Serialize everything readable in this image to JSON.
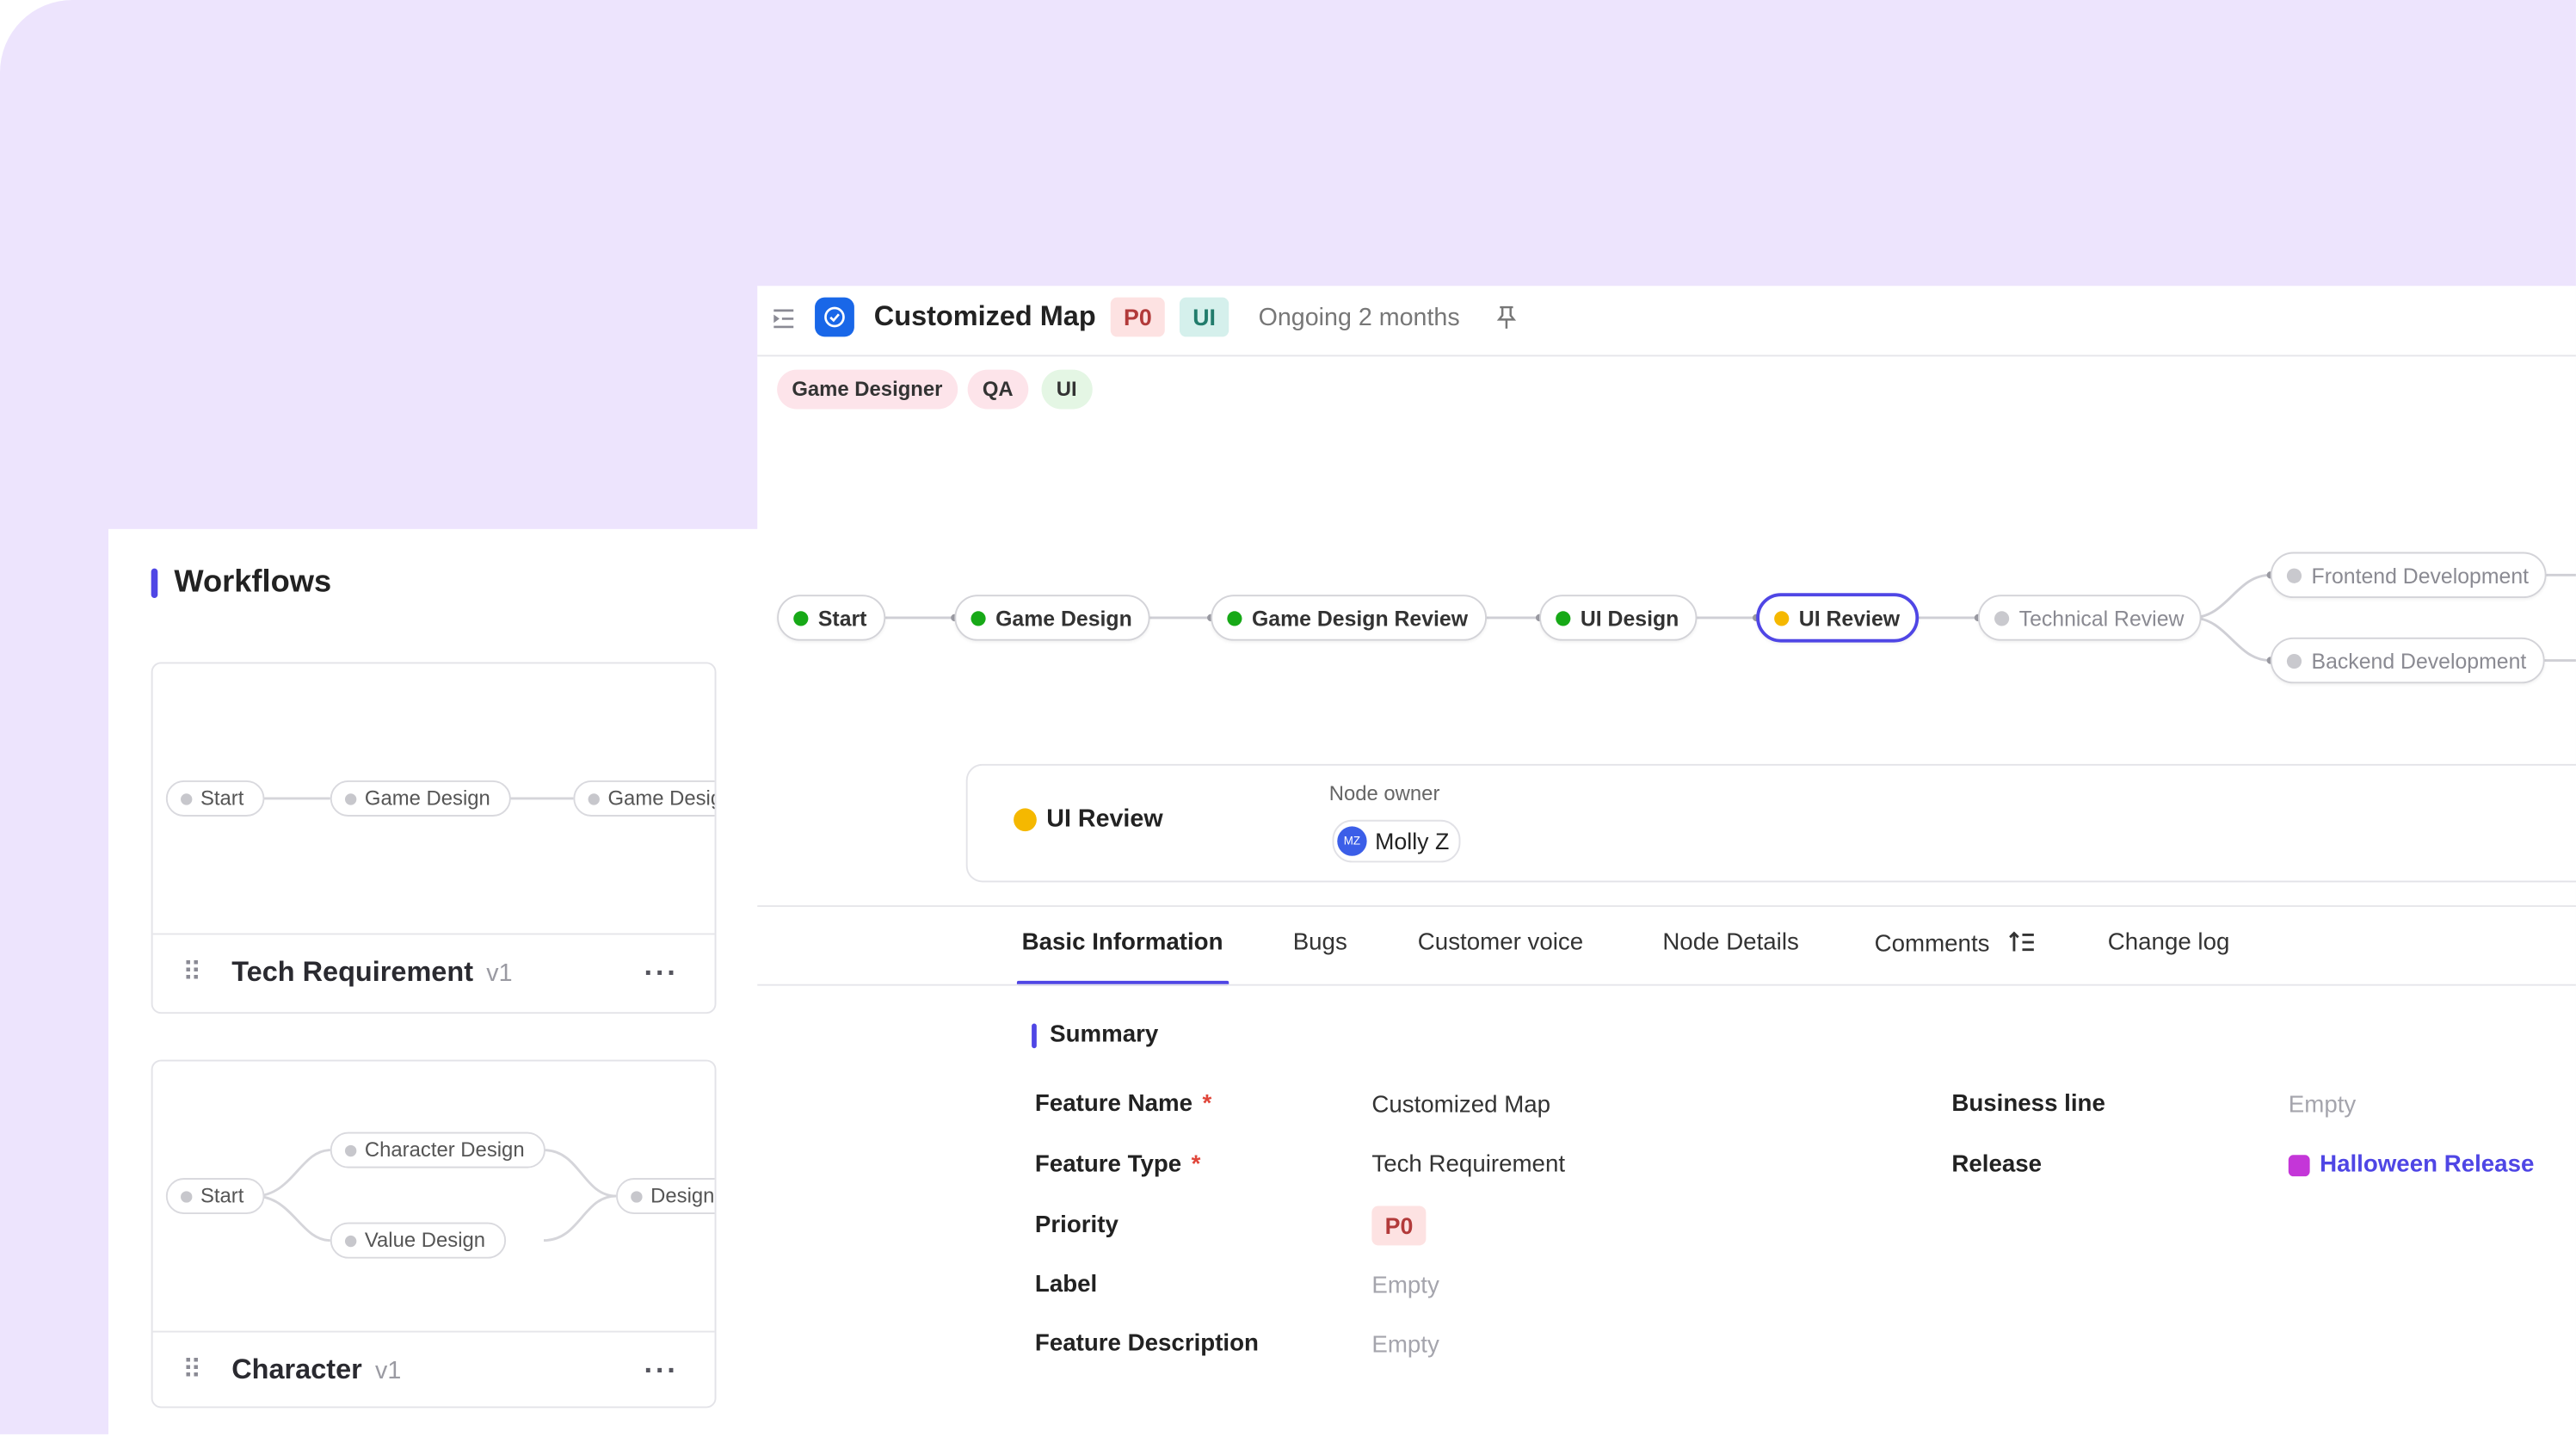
{
  "workflows": {
    "title": "Workflows",
    "cards": [
      {
        "name": "Tech Requirement",
        "version": "v1",
        "nodes": [
          "Start",
          "Game Design",
          "Game Desig"
        ]
      },
      {
        "name": "Character",
        "version": "v1",
        "nodes": [
          "Start",
          "Character Design",
          "Value Design",
          "Design"
        ]
      }
    ]
  },
  "header": {
    "title": "Customized Map",
    "priority_badge": "P0",
    "ui_badge": "UI",
    "status": "Ongoing 2 months",
    "tags": [
      "Game Designer",
      "QA",
      "UI"
    ]
  },
  "flow": {
    "nodes": [
      {
        "label": "Start",
        "state": "done"
      },
      {
        "label": "Game Design",
        "state": "done"
      },
      {
        "label": "Game Design Review",
        "state": "done"
      },
      {
        "label": "UI Design",
        "state": "done"
      },
      {
        "label": "UI Review",
        "state": "active"
      },
      {
        "label": "Technical Review",
        "state": "pending"
      },
      {
        "label": "Frontend Development",
        "state": "pending"
      },
      {
        "label": "Backend Development",
        "state": "pending"
      }
    ]
  },
  "node_card": {
    "title": "UI Review",
    "owner_label": "Node owner",
    "owner_initials": "MZ",
    "owner_name": "Molly Z"
  },
  "tabs": [
    "Basic Information",
    "Bugs",
    "Customer voice",
    "Node Details",
    "Comments",
    "Change log"
  ],
  "summary": {
    "heading": "Summary",
    "fields": {
      "feature_name": {
        "label": "Feature Name",
        "value": "Customized Map"
      },
      "feature_type": {
        "label": "Feature Type",
        "value": "Tech Requirement"
      },
      "priority": {
        "label": "Priority",
        "value": "P0"
      },
      "label": {
        "label": "Label",
        "value": "Empty"
      },
      "feature_description": {
        "label": "Feature Description",
        "value": "Empty"
      },
      "business_line": {
        "label": "Business line",
        "value": "Empty"
      },
      "release": {
        "label": "Release",
        "value": "Halloween Release"
      }
    },
    "required_mark": "*"
  },
  "colors": {
    "accent": "#4f46e5",
    "background": "#ede4fd",
    "done": "#17a917",
    "active": "#f5b800",
    "release": "#c436d8"
  }
}
